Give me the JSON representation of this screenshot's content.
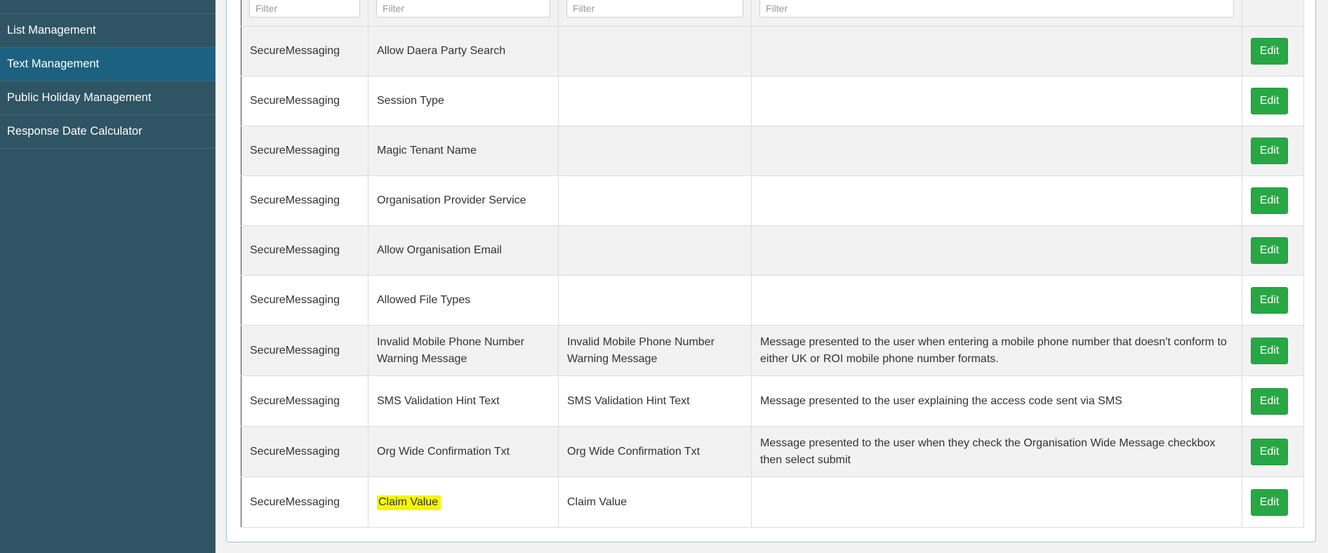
{
  "sidebar": {
    "items": [
      {
        "label": "List Management",
        "active": false
      },
      {
        "label": "Text Management",
        "active": true
      },
      {
        "label": "Public Holiday Management",
        "active": false
      },
      {
        "label": "Response Date Calculator",
        "active": false
      }
    ]
  },
  "table": {
    "filter_placeholder": "Filter",
    "edit_label": "Edit",
    "rows": [
      {
        "col1": "SecureMessaging",
        "col2": "Allow Daera Party Search",
        "col3": "",
        "col4": ""
      },
      {
        "col1": "SecureMessaging",
        "col2": "Session Type",
        "col3": "",
        "col4": ""
      },
      {
        "col1": "SecureMessaging",
        "col2": "Magic Tenant Name",
        "col3": "",
        "col4": ""
      },
      {
        "col1": "SecureMessaging",
        "col2": "Organisation Provider Service",
        "col3": "",
        "col4": ""
      },
      {
        "col1": "SecureMessaging",
        "col2": "Allow Organisation Email",
        "col3": "",
        "col4": ""
      },
      {
        "col1": "SecureMessaging",
        "col2": "Allowed File Types",
        "col3": "",
        "col4": ""
      },
      {
        "col1": "SecureMessaging",
        "col2": "Invalid Mobile Phone Number Warning Message",
        "col3": "Invalid Mobile Phone Number Warning Message",
        "col4": "Message presented to the user when entering a mobile phone number that doesn't conform to either UK or ROI mobile phone number formats."
      },
      {
        "col1": "SecureMessaging",
        "col2": "SMS Validation Hint Text",
        "col3": "SMS Validation Hint Text",
        "col4": "Message presented to the user explaining the access code sent via SMS"
      },
      {
        "col1": "SecureMessaging",
        "col2": "Org Wide Confirmation Txt",
        "col3": "Org Wide Confirmation Txt",
        "col4": "Message presented to the user when they check the Organisation Wide Message checkbox then select submit"
      },
      {
        "col1": "SecureMessaging",
        "col2": "Claim Value",
        "col3": "Claim Value",
        "col4": ""
      }
    ]
  }
}
